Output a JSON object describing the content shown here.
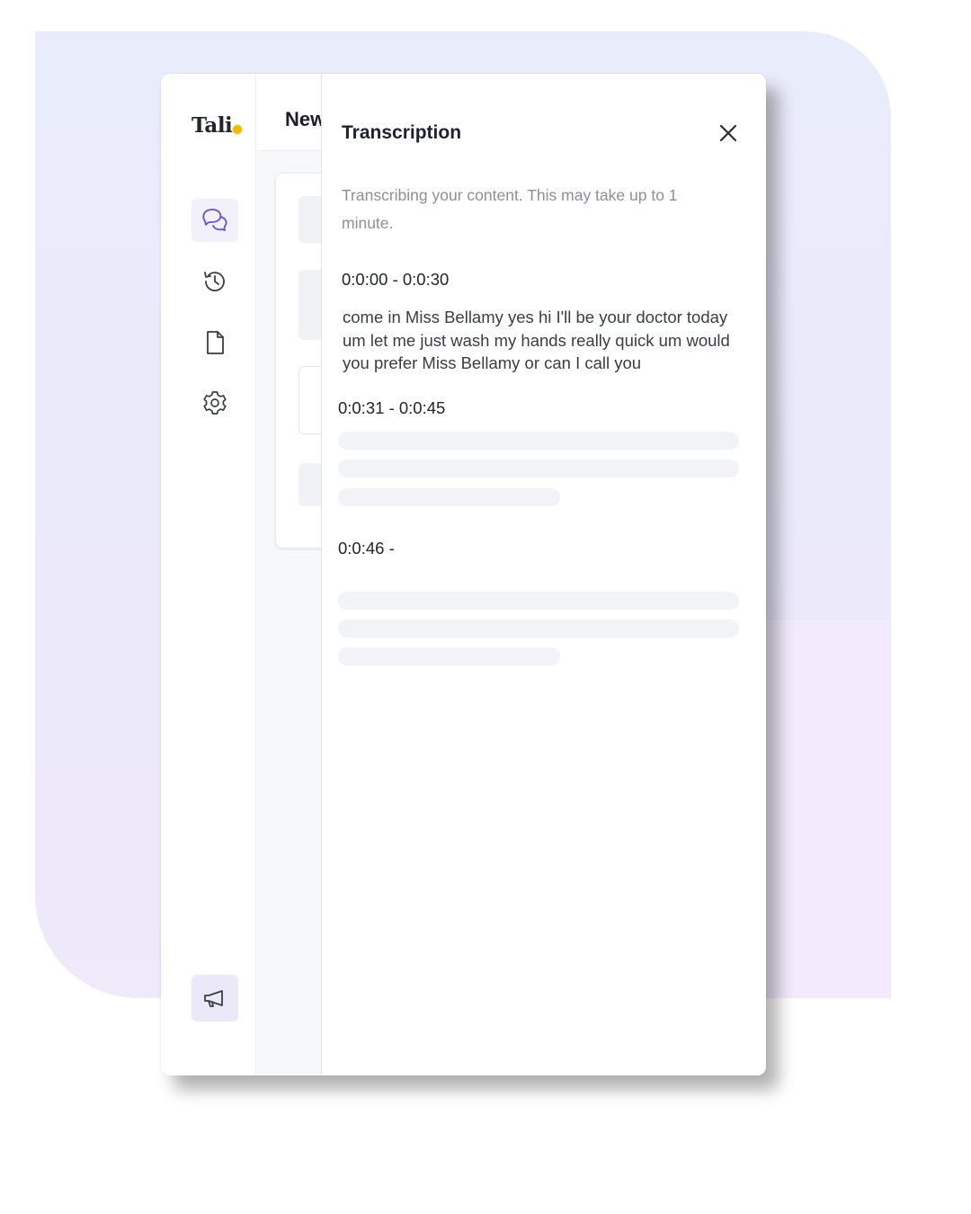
{
  "app": {
    "logo_text": "Tali"
  },
  "sidebar": {
    "items": [
      {
        "icon": "chat-bubbles-icon",
        "active": true
      },
      {
        "icon": "history-icon",
        "active": false
      },
      {
        "icon": "document-icon",
        "active": false
      },
      {
        "icon": "gear-icon",
        "active": false
      }
    ],
    "footer_icon": "megaphone-icon"
  },
  "main": {
    "title": "New"
  },
  "drawer": {
    "title": "Transcription",
    "close_icon": "close-icon",
    "note": "Transcribing your content. This may take up to 1 minute.",
    "segments": [
      {
        "time": "0:0:00 - 0:0:30",
        "text": "come in Miss Bellamy yes hi I'll be your doctor today um let me just wash my hands really quick um would you prefer Miss Bellamy or can I call you",
        "loading": false
      },
      {
        "time": "0:0:31 - 0:0:45",
        "text": "",
        "loading": true
      },
      {
        "time": "0:0:46 -",
        "text": "",
        "loading": true
      }
    ]
  },
  "colors": {
    "accent": "#7c5cd6",
    "logo_dot": "#f5b90a",
    "active_nav_bg": "#f1f0fb",
    "skeleton": "#f2f3f7"
  }
}
